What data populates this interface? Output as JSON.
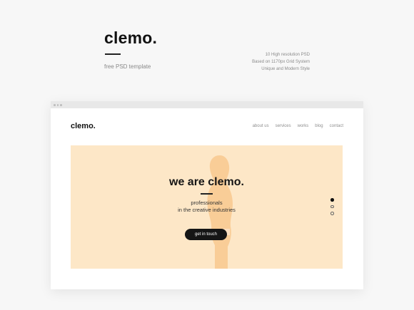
{
  "title": {
    "brand": "clemo.",
    "subtitle": "free PSD template"
  },
  "features": [
    "10 High resolution PSD",
    "Based on 1170px Grid System",
    "Unique and Modern Style"
  ],
  "site": {
    "logo": "clemo.",
    "nav": [
      "about us",
      "services",
      "works",
      "blog",
      "contact"
    ],
    "hero": {
      "title": "we are clemo.",
      "subtitle_line1": "professionals",
      "subtitle_line2": "in the creative industries",
      "cta": "get in touch"
    },
    "pager": {
      "count": 3,
      "active": 1
    }
  },
  "colors": {
    "hero_bg": "#fde7c7",
    "silhouette": "#f8c88e",
    "button": "#151515",
    "page_bg": "#f7f7f7"
  }
}
